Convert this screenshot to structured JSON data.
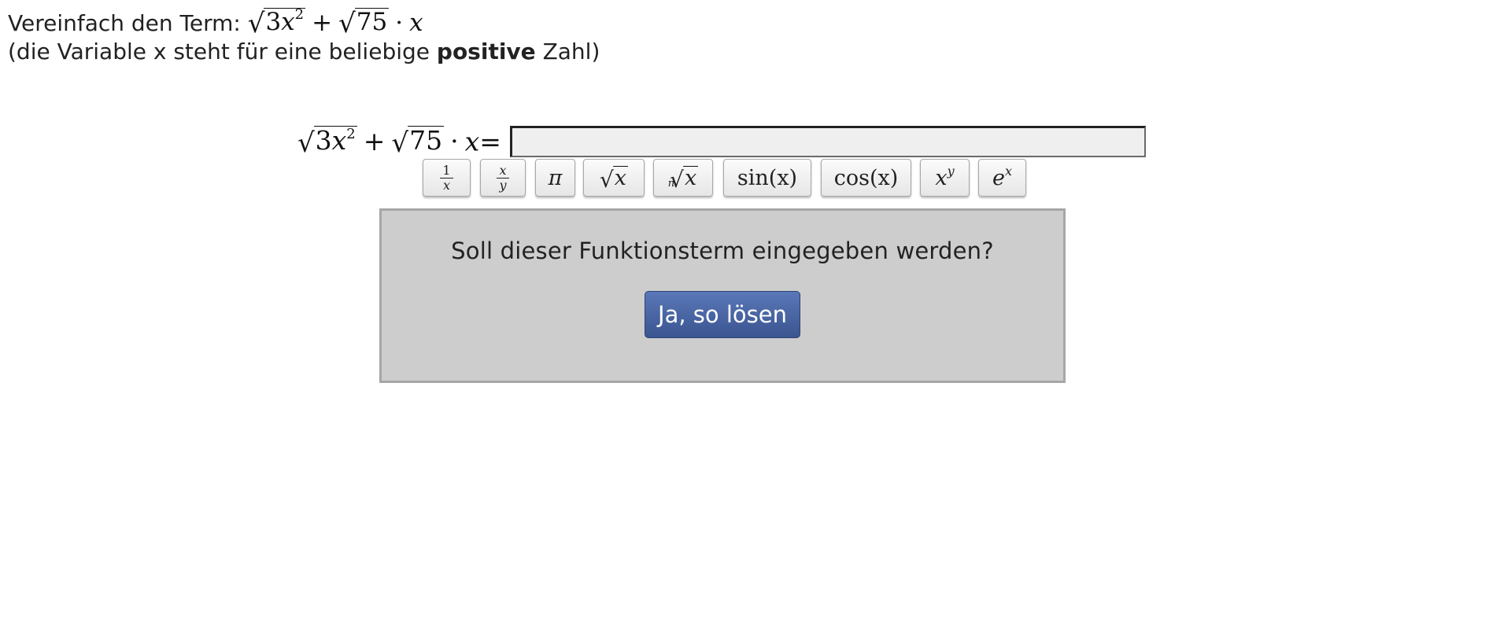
{
  "task": {
    "prefix": "Vereinfach den Term:",
    "hint_before": "(die Variable x steht für eine beliebige",
    "hint_bold": "positive",
    "hint_after": "Zahl)"
  },
  "term": {
    "coef1": "3",
    "var": "x",
    "exp": "2",
    "plus": "+",
    "coef2": "75",
    "dot": "·",
    "equals": "="
  },
  "answer": {
    "value": "",
    "placeholder": ""
  },
  "keypad": {
    "recip_num": "1",
    "recip_den": "x",
    "frac_num": "x",
    "frac_den": "y",
    "pi": "π",
    "sqrt_arg": "x",
    "nroot_index": "n",
    "nroot_arg": "x",
    "sin": "sin(x)",
    "cos": "cos(x)",
    "pow_base": "x",
    "pow_exp": "y",
    "exp_base": "e",
    "exp_exp": "x"
  },
  "confirm": {
    "question": "Soll dieser Funktionsterm eingegeben werden?",
    "button": "Ja, so lösen"
  },
  "colors": {
    "button_top": "#5a77b8",
    "button_bottom": "#3a5590",
    "panel_bg": "#cdcdcd",
    "input_bg": "#efefef"
  }
}
